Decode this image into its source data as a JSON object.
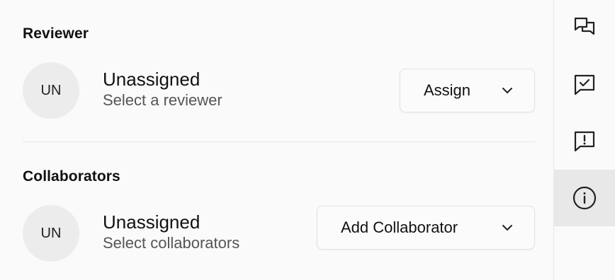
{
  "reviewer": {
    "title": "Reviewer",
    "avatar_initials": "UN",
    "name": "Unassigned",
    "subtitle": "Select a reviewer",
    "button_label": "Assign"
  },
  "collaborators": {
    "title": "Collaborators",
    "avatar_initials": "UN",
    "name": "Unassigned",
    "subtitle": "Select collaborators",
    "button_label": "Add Collaborator"
  },
  "rail": {
    "items": [
      {
        "icon": "comments-icon",
        "active": false
      },
      {
        "icon": "message-check-icon",
        "active": false
      },
      {
        "icon": "message-alert-icon",
        "active": false
      },
      {
        "icon": "info-icon",
        "active": true
      }
    ]
  },
  "colors": {
    "background": "#fafafa",
    "active_rail": "#e8e8e8",
    "avatar_bg": "#ececec",
    "border": "#e3e3e3",
    "muted_text": "#555555"
  }
}
